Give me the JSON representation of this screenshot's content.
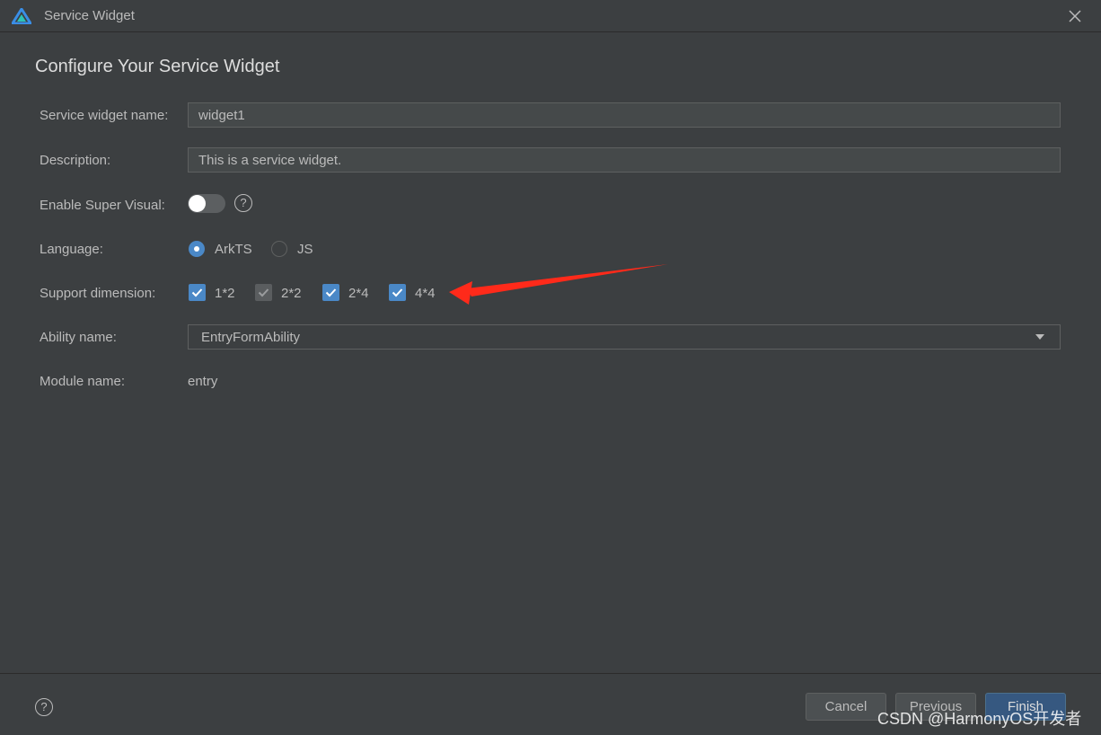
{
  "window": {
    "title": "Service Widget",
    "logo_icon": "harmonyos-deveco-logo"
  },
  "page": {
    "heading": "Configure Your Service Widget"
  },
  "form": {
    "name": {
      "label": "Service widget name:",
      "value": "widget1"
    },
    "description": {
      "label": "Description:",
      "value": "This is a service widget."
    },
    "super_visual": {
      "label": "Enable Super Visual:",
      "enabled": false
    },
    "language": {
      "label": "Language:",
      "options": [
        {
          "label": "ArkTS",
          "selected": true
        },
        {
          "label": "JS",
          "selected": false
        }
      ]
    },
    "dimension": {
      "label": "Support dimension:",
      "options": [
        {
          "label": "1*2",
          "checked": true,
          "disabled": false
        },
        {
          "label": "2*2",
          "checked": true,
          "disabled": true
        },
        {
          "label": "2*4",
          "checked": true,
          "disabled": false
        },
        {
          "label": "4*4",
          "checked": true,
          "disabled": false
        }
      ]
    },
    "ability": {
      "label": "Ability name:",
      "value": "EntryFormAbility"
    },
    "module": {
      "label": "Module name:",
      "value": "entry"
    }
  },
  "footer": {
    "cancel_label": "Cancel",
    "previous_label": "Previous",
    "finish_label": "Finish"
  },
  "watermark": "CSDN @HarmonyOS开发者",
  "colors": {
    "background": "#3c3f41",
    "accent": "#4a88c7",
    "annotation": "#ff2a1a"
  }
}
